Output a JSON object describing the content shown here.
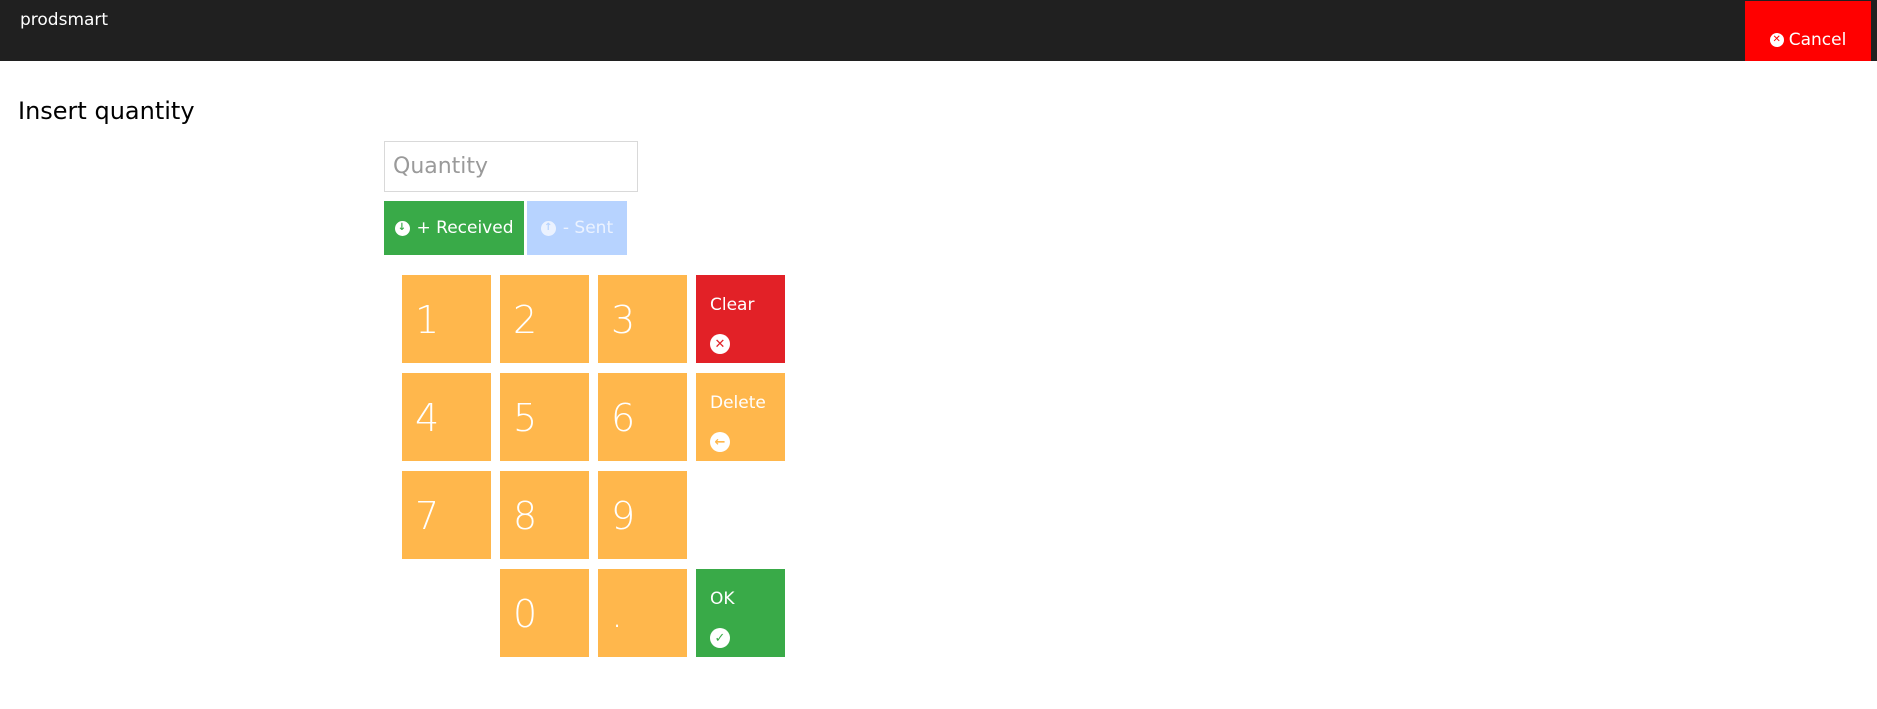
{
  "header": {
    "brand": "prodsmart",
    "cancel_label": "Cancel",
    "cancel_icon": "times-circle-icon",
    "background": "#202020",
    "cancel_color": "#ff0000"
  },
  "page": {
    "title": "Insert quantity"
  },
  "quantity": {
    "value": "",
    "placeholder": "Quantity"
  },
  "direction": {
    "received_label": "+ Received",
    "received_icon": "arrow-down-circle-icon",
    "received_color": "#39aa48",
    "sent_label": "- Sent",
    "sent_icon": "arrow-up-circle-icon",
    "sent_color": "#b7d3ff"
  },
  "keypad": {
    "keys": [
      "1",
      "2",
      "3",
      "4",
      "5",
      "6",
      "7",
      "8",
      "9",
      "0",
      "."
    ],
    "key_color": "#ffb74c",
    "clear_label": "Clear",
    "clear_icon": "times-circle-icon",
    "clear_color": "#e22127",
    "delete_label": "Delete",
    "delete_icon": "arrow-left-circle-icon",
    "ok_label": "OK",
    "ok_icon": "check-circle-icon",
    "ok_color": "#39aa48"
  }
}
